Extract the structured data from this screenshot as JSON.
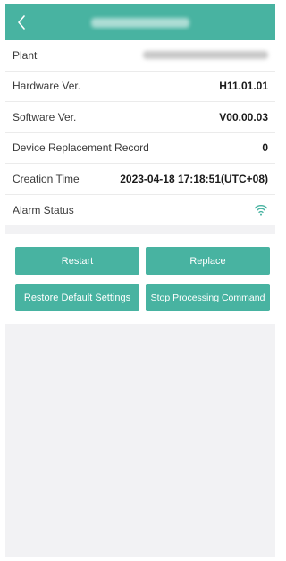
{
  "header": {
    "title": "",
    "back_icon": "chevron-left-icon"
  },
  "rows": [
    {
      "label": "Plant",
      "value": ""
    },
    {
      "label": "Hardware Ver.",
      "value": "H11.01.01"
    },
    {
      "label": "Software Ver.",
      "value": "V00.00.03"
    },
    {
      "label": "Device Replacement Record",
      "value": "0"
    },
    {
      "label": "Creation Time",
      "value": "2023-04-18 17:18:51(UTC+08)"
    },
    {
      "label": "Alarm Status",
      "icon": "wifi-icon"
    }
  ],
  "buttons": {
    "restart": "Restart",
    "replace": "Replace",
    "restore": "Restore Default Settings",
    "stop": "Stop Processing Command"
  },
  "colors": {
    "accent": "#48b3a1",
    "background": "#f2f2f4"
  }
}
